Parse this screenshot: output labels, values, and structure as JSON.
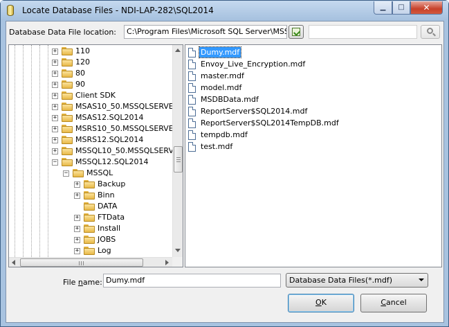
{
  "window": {
    "title": "Locate Database Files - NDI-LAP-282\\SQL2014",
    "minimize_glyph": "▁",
    "maximize_glyph": "□",
    "close_glyph": "✕"
  },
  "location": {
    "label": "Database Data File location:",
    "value": "C:\\Program Files\\Microsoft SQL Server\\MSSQ",
    "search_value": ""
  },
  "tree": {
    "items": [
      {
        "label": "110",
        "expander": "+"
      },
      {
        "label": "120",
        "expander": "+"
      },
      {
        "label": "80",
        "expander": "+"
      },
      {
        "label": "90",
        "expander": "+"
      },
      {
        "label": "Client SDK",
        "expander": "+"
      },
      {
        "label": "MSAS10_50.MSSQLSERVE",
        "expander": "+"
      },
      {
        "label": "MSAS12.SQL2014",
        "expander": "+"
      },
      {
        "label": "MSRS10_50.MSSQLSERVE",
        "expander": "+"
      },
      {
        "label": "MSRS12.SQL2014",
        "expander": "+"
      },
      {
        "label": "MSSQL10_50.MSSQLSERV",
        "expander": "+"
      },
      {
        "label": "MSSQL12.SQL2014",
        "expander": "−"
      },
      {
        "label": "MSSQL",
        "expander": "−"
      },
      {
        "label": "Backup",
        "expander": "+"
      },
      {
        "label": "Binn",
        "expander": "+"
      },
      {
        "label": "DATA",
        "expander": ""
      },
      {
        "label": "FTData",
        "expander": "+"
      },
      {
        "label": "Install",
        "expander": "+"
      },
      {
        "label": "JOBS",
        "expander": "+"
      },
      {
        "label": "Log",
        "expander": "+"
      }
    ]
  },
  "files": {
    "selected_index": 0,
    "items": [
      "Dumy.mdf",
      "Envoy_Live_Encryption.mdf",
      "master.mdf",
      "model.mdf",
      "MSDBData.mdf",
      "ReportServer$SQL2014.mdf",
      "ReportServer$SQL2014TempDB.mdf",
      "tempdb.mdf",
      "test.mdf"
    ]
  },
  "bottom": {
    "file_name_label_pre": "File ",
    "file_name_label_accel": "n",
    "file_name_label_post": "ame:",
    "file_name_value": "Dumy.mdf",
    "file_type": "Database Data Files(*.mdf)",
    "ok_label": "OK",
    "ok_accel": "O",
    "ok_rest": "K",
    "cancel_accel": "C",
    "cancel_rest": "ancel"
  },
  "icons": {
    "title": "database-cylinder-icon",
    "location_button": "refresh-folder-icon",
    "search": "magnifier-icon",
    "folder": "folder-icon",
    "file": "document-icon"
  },
  "colors": {
    "selection": "#3399ff",
    "title_gradient_top": "#c5d9ef",
    "close_button": "#c7412a",
    "folder": "#fbe39b"
  }
}
